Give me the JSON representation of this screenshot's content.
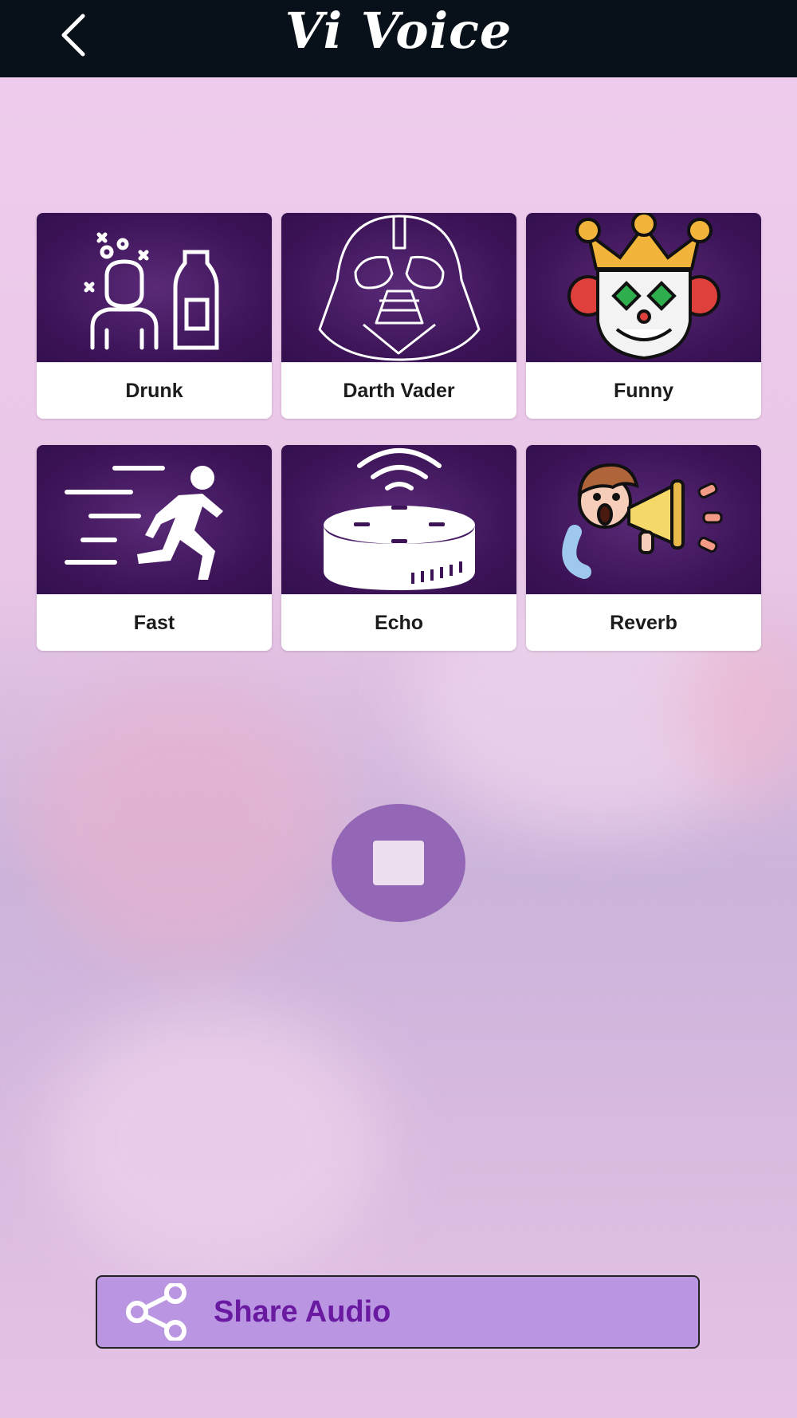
{
  "app": {
    "title": "Vi Voice"
  },
  "header": {
    "back_icon": "chevron-left-icon"
  },
  "effects": [
    {
      "label": "Drunk",
      "icon": "drunk-person-bottle-icon"
    },
    {
      "label": "Darth Vader",
      "icon": "darth-vader-helmet-icon"
    },
    {
      "label": "Funny",
      "icon": "clown-face-icon"
    },
    {
      "label": "Fast",
      "icon": "running-man-icon"
    },
    {
      "label": "Echo",
      "icon": "smart-speaker-icon"
    },
    {
      "label": "Reverb",
      "icon": "megaphone-man-icon"
    }
  ],
  "player": {
    "stop_icon": "stop-icon"
  },
  "share": {
    "label": "Share Audio",
    "icon": "share-icon"
  },
  "colors": {
    "header_bg": "#08111a",
    "card_art_bg": "#3b1356",
    "share_bg": "#b995e2",
    "share_text": "#6a1aa0",
    "stop_bg": "#9366b6"
  }
}
